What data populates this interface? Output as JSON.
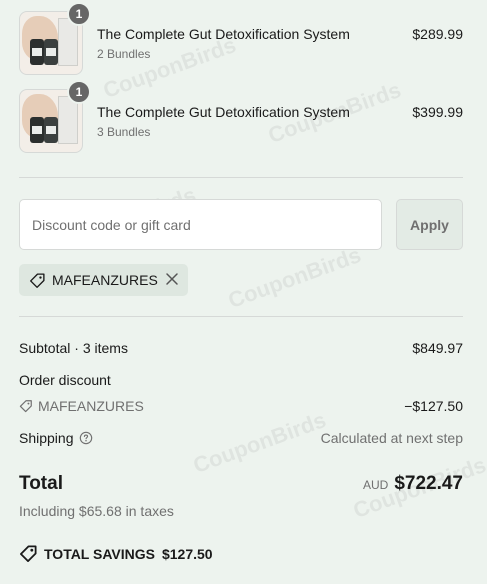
{
  "items": [
    {
      "title": "The Complete Gut Detoxification System",
      "variant": "2 Bundles",
      "price": "$289.99",
      "quantity": "1"
    },
    {
      "title": "The Complete Gut Detoxification System",
      "variant": "3 Bundles",
      "price": "$399.99",
      "quantity": "1"
    }
  ],
  "discount": {
    "placeholder": "Discount code or gift card",
    "apply_label": "Apply",
    "applied_code": "MAFEANZURES"
  },
  "summary": {
    "subtotal_label": "Subtotal · 3 items",
    "subtotal_value": "$849.97",
    "order_discount_label": "Order discount",
    "discount_code": "MAFEANZURES",
    "discount_value": "−$127.50",
    "shipping_label": "Shipping",
    "shipping_value": "Calculated at next step",
    "total_label": "Total",
    "currency": "AUD",
    "total_value": "$722.47",
    "tax_note": "Including $65.68 in taxes",
    "savings_label": "TOTAL SAVINGS",
    "savings_value": "$127.50"
  },
  "watermark": "CouponBirds",
  "icons": {
    "quantity_badge": "quantity-badge",
    "discount_tag": "tag-icon",
    "remove": "close-icon",
    "shipping_help": "question-circle-icon"
  }
}
